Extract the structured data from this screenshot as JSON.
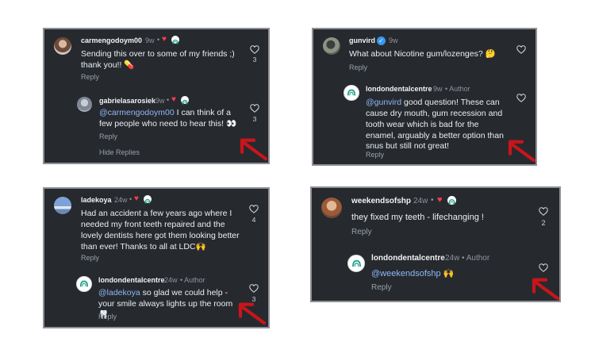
{
  "colors": {
    "panel_bg": "#262a2f",
    "panel_border": "#8e9094",
    "mention": "#8fb6f5",
    "heart_red": "#ff3b50",
    "arrow_red": "#c8151b"
  },
  "icons": {
    "like": "heart-outline-icon",
    "liked_by_author": "red-heart-icon",
    "author_badge": "ldc-logo-icon",
    "annotation": "red-arrow"
  },
  "panel1": {
    "c1": {
      "user": "carmengodoym00",
      "time": "9w",
      "text": "Sending this over to some of my friends ;) thank you!! 💊",
      "reply": "Reply",
      "likes": "3"
    },
    "c2": {
      "user": "gabrielasarosiek",
      "time": "9w",
      "mention": "@carmengodoym00",
      "text": " I can think of a few people who need to hear this! 👀",
      "reply": "Reply",
      "likes": "3",
      "hide": "Hide Replies"
    }
  },
  "panel2": {
    "c1": {
      "user": "gunvird",
      "time": "9w",
      "text": "What about Nicotine gum/lozenges? 🤔",
      "reply": "Reply"
    },
    "c2": {
      "user": "londondentalcentre",
      "time": "9w",
      "author": "• Author",
      "mention": "@gunvird",
      "text": " good question! These can cause dry mouth, gum recession and tooth wear which is bad for the enamel, arguably a better option than snus but still not great!",
      "reply": "Reply"
    }
  },
  "panel3": {
    "c1": {
      "user": "ladekoya",
      "time": "24w",
      "text": "Had an accident a few years ago where I needed my front teeth repaired and the lovely dentists here got them looking better than ever! Thanks to all at LDC🙌",
      "reply": "Reply",
      "likes": "4"
    },
    "c2": {
      "user": "londondentalcentre",
      "time": "24w",
      "author": "• Author",
      "mention": "@ladekoya",
      "text": " so glad we could help - your smile always lights up the room 🦷",
      "reply": "Reply",
      "likes": "3"
    }
  },
  "panel4": {
    "c1": {
      "user": "weekendsofshp",
      "time": "24w",
      "text": "they fixed my teeth - lifechanging !",
      "reply": "Reply",
      "likes": "2"
    },
    "c2": {
      "user": "londondentalcentre",
      "time": "24w",
      "author": "• Author",
      "mention": "@weekendsofshp",
      "text": " 🙌",
      "reply": "Reply"
    }
  }
}
